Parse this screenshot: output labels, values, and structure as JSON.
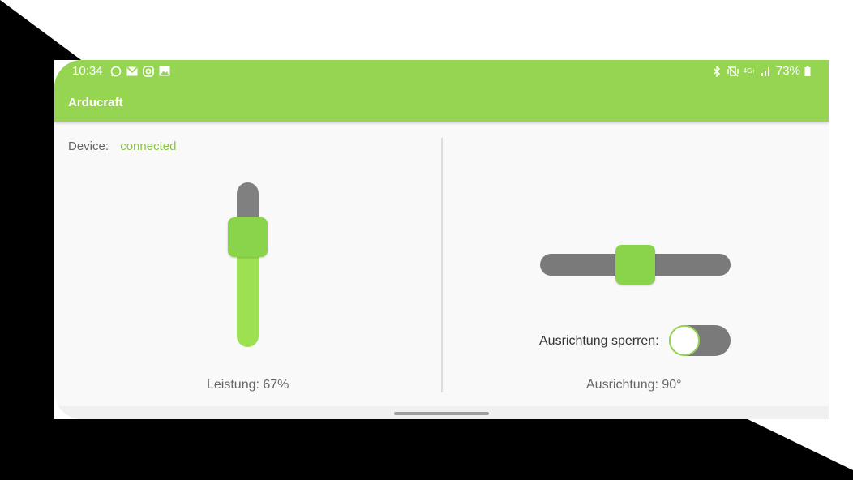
{
  "colors": {
    "accent": "#96d552",
    "thumb": "#8ad44c",
    "track": "#7a7a7a",
    "connected": "#8bc34a"
  },
  "statusbar": {
    "time": "10:34",
    "notification_icons": [
      "whatsapp-icon",
      "mail-icon",
      "instagram-icon",
      "image-icon"
    ],
    "system_icons": [
      "bluetooth-icon",
      "vibrate-icon",
      "lte-icon",
      "signal-icon",
      "battery-icon"
    ],
    "lte_label": "4G+",
    "battery": "73%"
  },
  "app": {
    "title": "Arducraft"
  },
  "device": {
    "label": "Device:",
    "status": "connected"
  },
  "power_slider": {
    "label": "Leistung: 67%",
    "level": 0.67
  },
  "orientation_slider": {
    "label": "Ausrichtung: 90°",
    "value": 90
  },
  "lock_toggle": {
    "label": "Ausrichtung sperren:",
    "checked": false
  }
}
